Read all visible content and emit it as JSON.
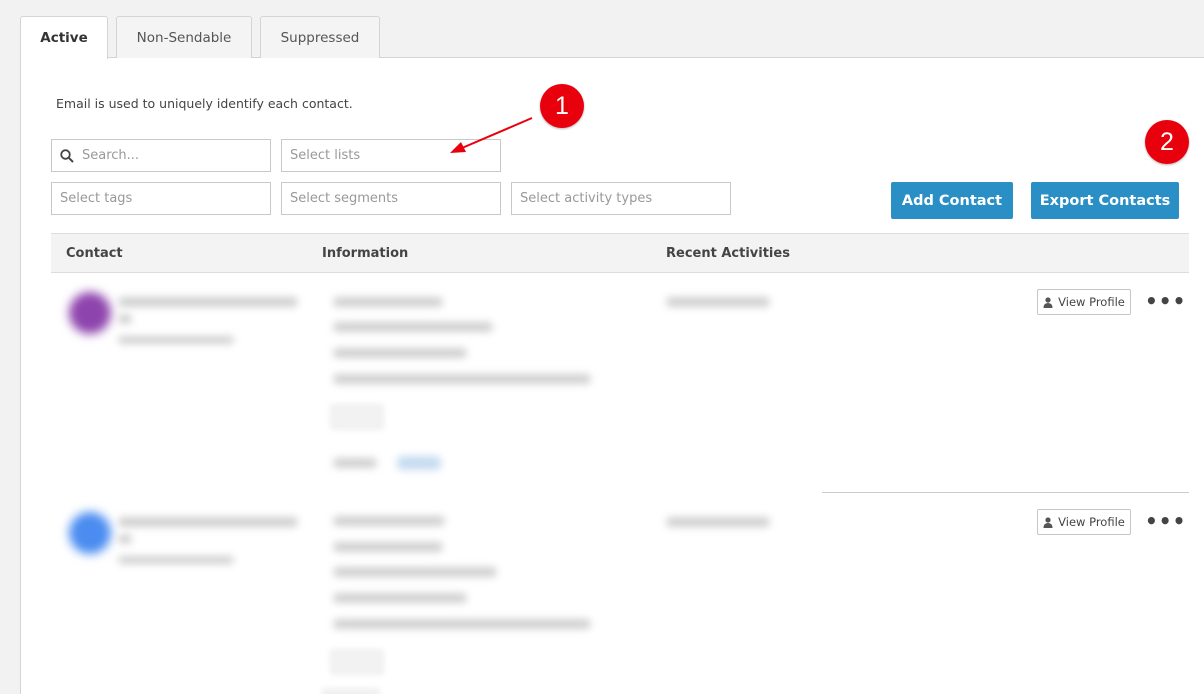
{
  "tabs": [
    {
      "label": "Active",
      "active": true
    },
    {
      "label": "Non-Sendable",
      "active": false
    },
    {
      "label": "Suppressed",
      "active": false
    }
  ],
  "info_text": "Email is used to uniquely identify each contact.",
  "filters": {
    "search_placeholder": "Search...",
    "lists_placeholder": "Select lists",
    "tags_placeholder": "Select tags",
    "segments_placeholder": "Select segments",
    "activity_placeholder": "Select activity types"
  },
  "buttons": {
    "add_contact": "Add Contact",
    "export_contacts": "Export Contacts"
  },
  "table": {
    "headers": [
      "Contact",
      "Information",
      "Recent Activities"
    ],
    "rows": [
      {
        "view_profile": "View Profile",
        "avatar_color": "#8e44ad"
      },
      {
        "view_profile": "View Profile",
        "avatar_color": "#4a8cf0"
      }
    ]
  },
  "annotations": {
    "badge_1": "1",
    "badge_2": "2",
    "color": "#e8000d"
  },
  "colors": {
    "accent": "#2a8fc4"
  }
}
